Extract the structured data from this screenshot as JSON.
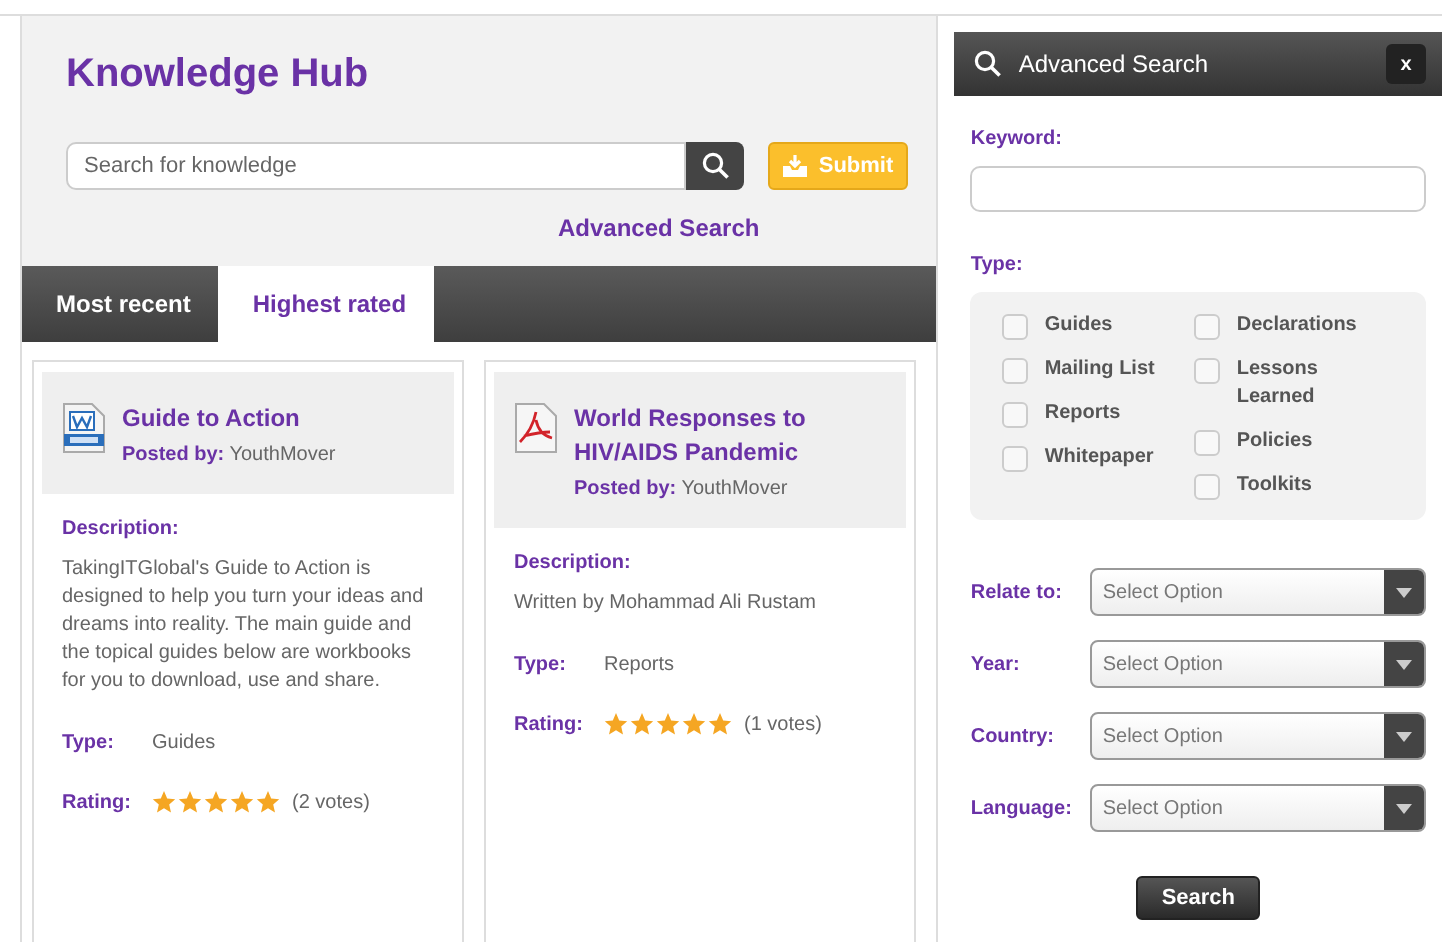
{
  "header": {
    "title": "Knowledge Hub",
    "search": {
      "placeholder": "Search for knowledge"
    },
    "submit": "Submit",
    "advanced_link": "Advanced Search"
  },
  "tabs": [
    {
      "label": "Most recent",
      "selected": false
    },
    {
      "label": "Highest rated",
      "selected": true
    }
  ],
  "cards": [
    {
      "kind": "doc",
      "title": "Guide to Action",
      "posted_label": "Posted by:",
      "author": "YouthMover",
      "description_label": "Description:",
      "description": "TakingITGlobal's Guide to Action is designed to help you turn your ideas and dreams into reality. The main guide and the topical guides below are workbooks for you to download, use and share.",
      "type_label": "Type:",
      "type": "Guides",
      "rating_label": "Rating:",
      "stars": 5,
      "votes": "(2 votes)"
    },
    {
      "kind": "pdf",
      "title": "World Responses to HIV/AIDS Pandemic",
      "posted_label": "Posted by:",
      "author": "YouthMover",
      "description_label": "Description:",
      "description": "Written by Mohammad Ali Rustam",
      "type_label": "Type:",
      "type": "Reports",
      "rating_label": "Rating:",
      "stars": 5,
      "votes": "(1 votes)"
    }
  ],
  "advanced": {
    "title": "Advanced Search",
    "close": "x",
    "keyword_label": "Keyword:",
    "type_label": "Type:",
    "types_left": [
      {
        "label": "Guides",
        "checked": false
      },
      {
        "label": "Mailing List",
        "checked": false
      },
      {
        "label": "Reports",
        "checked": false
      },
      {
        "label": "Whitepaper",
        "checked": false
      }
    ],
    "types_right": [
      {
        "label": "Declarations",
        "checked": false
      },
      {
        "label": "Lessons Learned",
        "checked": false
      },
      {
        "label": "Policies",
        "checked": false
      },
      {
        "label": "Toolkits",
        "checked": false
      }
    ],
    "selects": [
      {
        "label": "Relate to:",
        "value": "Select Option"
      },
      {
        "label": "Year:",
        "value": "Select Option"
      },
      {
        "label": "Country:",
        "value": "Select Option"
      },
      {
        "label": "Language:",
        "value": "Select Option"
      }
    ],
    "search_button": "Search"
  }
}
